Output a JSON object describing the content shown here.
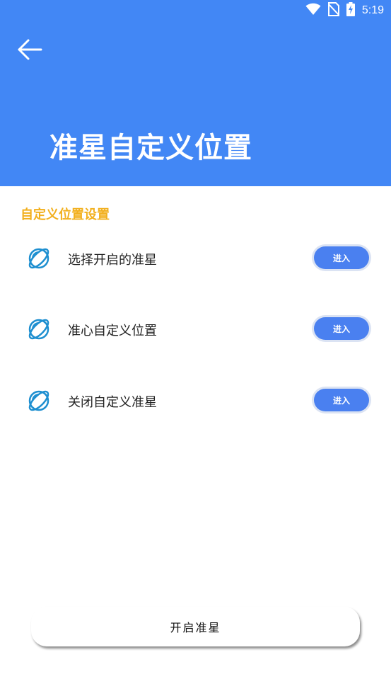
{
  "status_bar": {
    "time": "5:19",
    "icons": [
      "wifi-icon",
      "no-sim-icon",
      "battery-charging-icon"
    ]
  },
  "header": {
    "back_icon": "arrow-left-icon",
    "title": "准星自定义位置"
  },
  "section": {
    "title": "自定义位置设置"
  },
  "items": [
    {
      "icon": "planet-icon",
      "label": "选择开启的准星",
      "button": "进入"
    },
    {
      "icon": "planet-icon",
      "label": "准心自定义位置",
      "button": "进入"
    },
    {
      "icon": "planet-icon",
      "label": "关闭自定义准星",
      "button": "进入"
    }
  ],
  "footer": {
    "main_button": "开启准星"
  },
  "colors": {
    "header_bg": "#4287f5",
    "section_title": "#f2b01e",
    "enter_button": "#4a80f0",
    "icon": "#1e8fd0"
  }
}
